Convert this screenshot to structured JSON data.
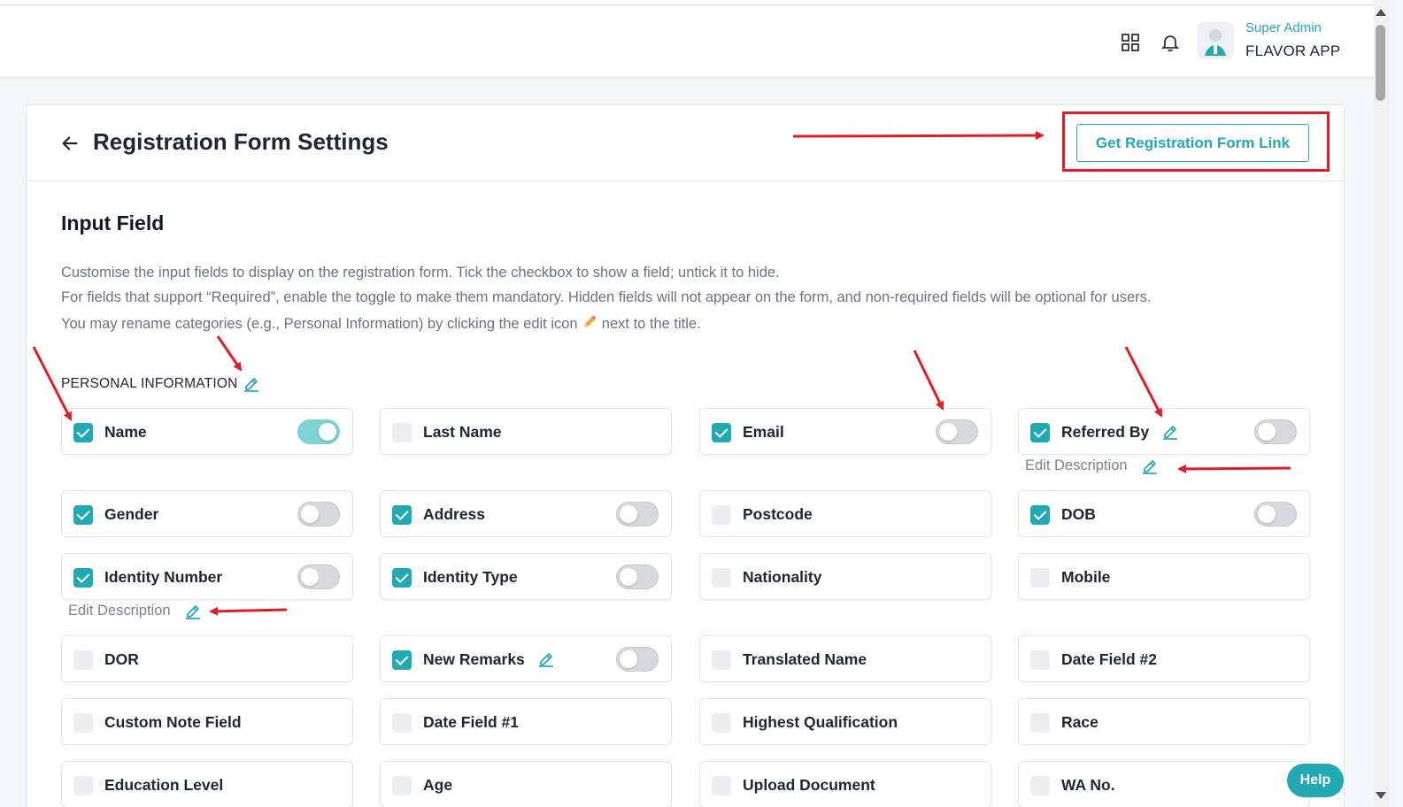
{
  "header": {
    "user_role": "Super Admin",
    "app_name": "FLAVOR APP",
    "icons": [
      "grid-icon",
      "bell-icon",
      "avatar"
    ]
  },
  "page": {
    "title": "Registration Form Settings",
    "get_link_label": "Get Registration Form Link"
  },
  "section": {
    "title": "Input Field",
    "desc_line1": "Customise the input fields to display on the registration form. Tick the checkbox to show a field; untick it to hide.",
    "desc_line2": "For fields that support “Required”, enable the toggle to make them mandatory. Hidden fields will not appear on the form, and non-required fields will be optional for users.",
    "desc_line3_a": "You may rename categories (e.g., Personal Information) by clicking the edit icon",
    "desc_line3_b": "next to the title."
  },
  "category": {
    "label": "PERSONAL INFORMATION"
  },
  "fields": [
    {
      "label": "Name",
      "checked": true,
      "toggle": "on"
    },
    {
      "label": "Last Name",
      "checked": false,
      "toggle": "none"
    },
    {
      "label": "Email",
      "checked": true,
      "toggle": "off"
    },
    {
      "label": "Referred By",
      "checked": true,
      "toggle": "off",
      "editable": true
    },
    {
      "label": "Gender",
      "checked": true,
      "toggle": "off"
    },
    {
      "label": "Address",
      "checked": true,
      "toggle": "off"
    },
    {
      "label": "Postcode",
      "checked": false,
      "toggle": "none"
    },
    {
      "label": "DOB",
      "checked": true,
      "toggle": "off"
    },
    {
      "label": "Identity Number",
      "checked": true,
      "toggle": "off"
    },
    {
      "label": "Identity Type",
      "checked": true,
      "toggle": "off"
    },
    {
      "label": "Nationality",
      "checked": false,
      "toggle": "none"
    },
    {
      "label": "Mobile",
      "checked": false,
      "toggle": "none"
    },
    {
      "label": "DOR",
      "checked": false,
      "toggle": "none"
    },
    {
      "label": "New Remarks",
      "checked": true,
      "toggle": "off",
      "editable": true
    },
    {
      "label": "Translated Name",
      "checked": false,
      "toggle": "none"
    },
    {
      "label": "Date Field #2",
      "checked": false,
      "toggle": "none"
    },
    {
      "label": "Custom Note Field",
      "checked": false,
      "toggle": "none"
    },
    {
      "label": "Date Field #1",
      "checked": false,
      "toggle": "none"
    },
    {
      "label": "Highest Qualification",
      "checked": false,
      "toggle": "none"
    },
    {
      "label": "Race",
      "checked": false,
      "toggle": "none"
    },
    {
      "label": "Education Level",
      "checked": false,
      "toggle": "none"
    },
    {
      "label": "Age",
      "checked": false,
      "toggle": "none"
    },
    {
      "label": "Upload Document",
      "checked": false,
      "toggle": "none"
    },
    {
      "label": "WA No.",
      "checked": false,
      "toggle": "none"
    }
  ],
  "edit_description_label": "Edit Description",
  "help_label": "Help",
  "colors": {
    "accent": "#21a9b4",
    "annotation": "#e31b23"
  }
}
